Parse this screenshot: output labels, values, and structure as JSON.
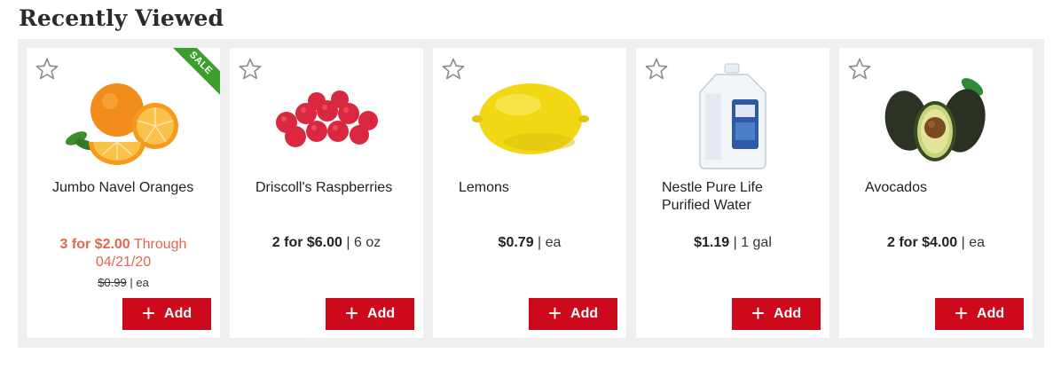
{
  "section": {
    "title": "Recently Viewed"
  },
  "cards": [
    {
      "name": "Jumbo Navel Oranges",
      "price_main": "3 for $2.00",
      "price_extra": "Through 04/21/20",
      "was_price": "$0.99",
      "was_unit": "ea",
      "sale_badge": "SALE",
      "add_plus": "+",
      "add_label": "Add",
      "icon": "star-outline-icon"
    },
    {
      "name": "Driscoll's Raspberries",
      "price_main": "2 for $6.00",
      "price_unit": "6 oz",
      "add_plus": "+",
      "add_label": "Add",
      "icon": "star-outline-icon"
    },
    {
      "name": "Lemons",
      "price_main": "$0.79",
      "price_unit": "ea",
      "add_plus": "+",
      "add_label": "Add",
      "icon": "star-outline-icon"
    },
    {
      "name": "Nestle Pure Life Purified Water",
      "price_main": "$1.19",
      "price_unit": "1 gal",
      "add_plus": "+",
      "add_label": "Add",
      "icon": "star-outline-icon"
    },
    {
      "name": "Avocados",
      "price_main": "2 for $4.00",
      "price_unit": "ea",
      "add_plus": "+",
      "add_label": "Add",
      "icon": "star-outline-icon"
    }
  ],
  "colors": {
    "accent": "#cc0a1c",
    "sale_text": "#e4664f",
    "sale_badge": "#3b9f2a",
    "tray": "#efefef"
  }
}
